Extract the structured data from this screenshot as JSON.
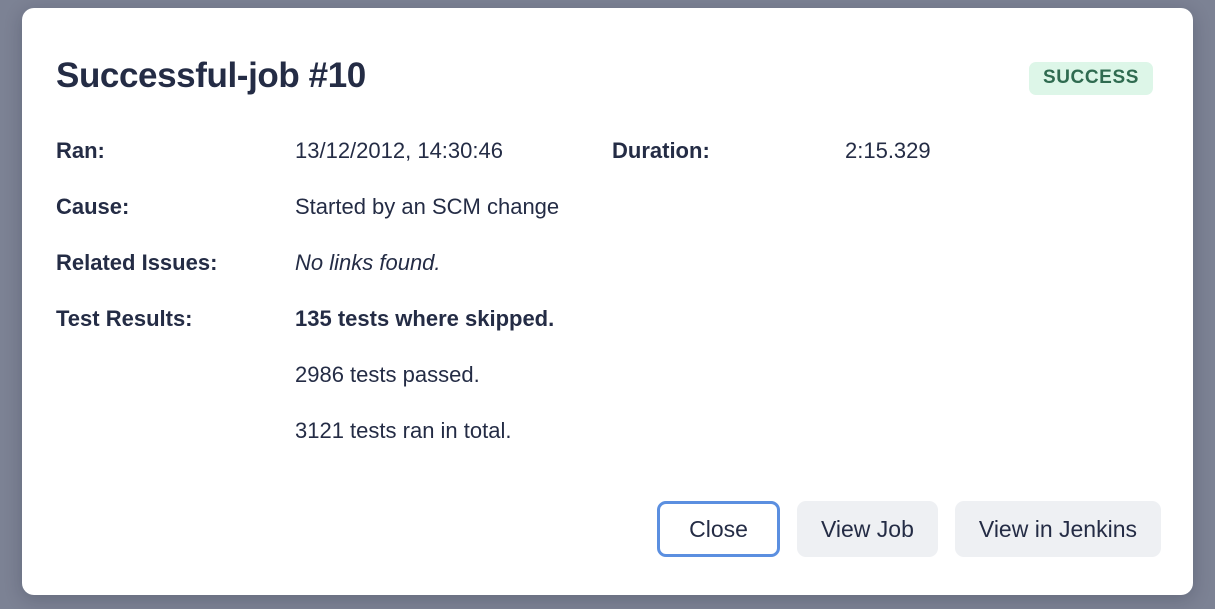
{
  "modal": {
    "title": "Successful-job #10",
    "status_badge": "SUCCESS",
    "colors": {
      "backdrop": "#7c8294",
      "surface": "#ffffff",
      "text": "#242c45",
      "badge_bg": "#ddf6e8",
      "badge_text": "#2f6b50",
      "button_bg": "#eef0f3",
      "focus_ring": "#5b8fe0"
    },
    "details": {
      "ran_label": "Ran:",
      "ran_value": "13/12/2012, 14:30:46",
      "duration_label": "Duration:",
      "duration_value": "2:15.329",
      "cause_label": "Cause:",
      "cause_value": "Started by an SCM change",
      "related_issues_label": "Related Issues:",
      "related_issues_value": "No links found.",
      "test_results_label": "Test Results:",
      "test_results_skipped": "135 tests where skipped.",
      "test_results_passed": "2986 tests passed.",
      "test_results_total": "3121 tests ran in total."
    },
    "footer": {
      "close_label": "Close",
      "view_job_label": "View Job",
      "view_in_jenkins_label": "View in Jenkins"
    }
  }
}
